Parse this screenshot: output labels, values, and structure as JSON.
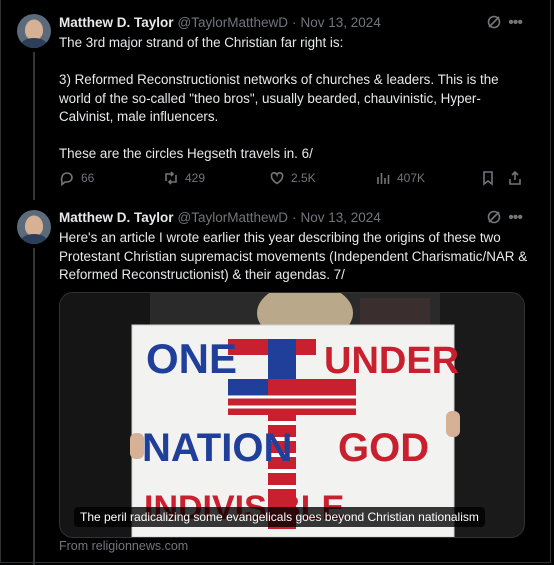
{
  "tweets": [
    {
      "name": "Matthew D. Taylor",
      "handle": "@TaylorMatthewD",
      "separator": "·",
      "date": "Nov 13, 2024",
      "text": "The 3rd major strand of the Christian far right is:\n\n3) Reformed Reconstructionist networks of churches & leaders. This is the world of the so-called \"theo bros\", usually bearded, chauvinistic, Hyper-Calvinist, male influencers.\n\nThese are the circles Hegseth travels in. 6/",
      "replies": "66",
      "reposts": "429",
      "likes": "2.5K",
      "views": "407K"
    },
    {
      "name": "Matthew D. Taylor",
      "handle": "@TaylorMatthewD",
      "separator": "·",
      "date": "Nov 13, 2024",
      "text": "Here's an article I wrote earlier this year describing the origins of these two Protestant Christian supremacist movements (Independent Charismatic/NAR & Reformed Reconstructionist) & their agendas. 7/"
    }
  ],
  "card": {
    "caption": "The peril radicalizing some evangelicals goes beyond Christian nationalism",
    "source": "From religionnews.com",
    "sign": {
      "line1_left": "ONE",
      "line1_right": "UNDER",
      "line2_left": "NATION",
      "line2_right": "GOD",
      "line3": "INDIVISIBLE"
    }
  },
  "colors": {
    "background": "#000000",
    "text": "#e7e9ea",
    "muted": "#71767b",
    "border": "#2f3336",
    "sign_blue": "#1f3f9a",
    "sign_red": "#c8202f"
  },
  "icons": [
    "grok-icon",
    "more-icon",
    "reply-icon",
    "repost-icon",
    "like-icon",
    "views-icon",
    "bookmark-icon",
    "share-icon"
  ]
}
